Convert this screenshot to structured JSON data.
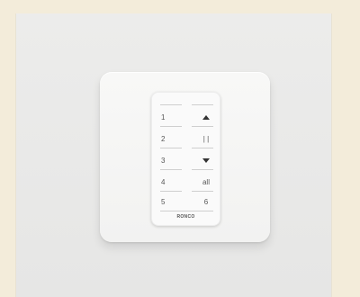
{
  "device": {
    "brand": "RONCO",
    "left_keys": [
      "1",
      "2",
      "3",
      "4",
      "5"
    ],
    "right_keys": [
      {
        "icon": "up-arrow-icon"
      },
      {
        "label": "| |"
      },
      {
        "icon": "down-arrow-icon"
      },
      {
        "label": "all"
      },
      {
        "label": "6"
      }
    ]
  }
}
